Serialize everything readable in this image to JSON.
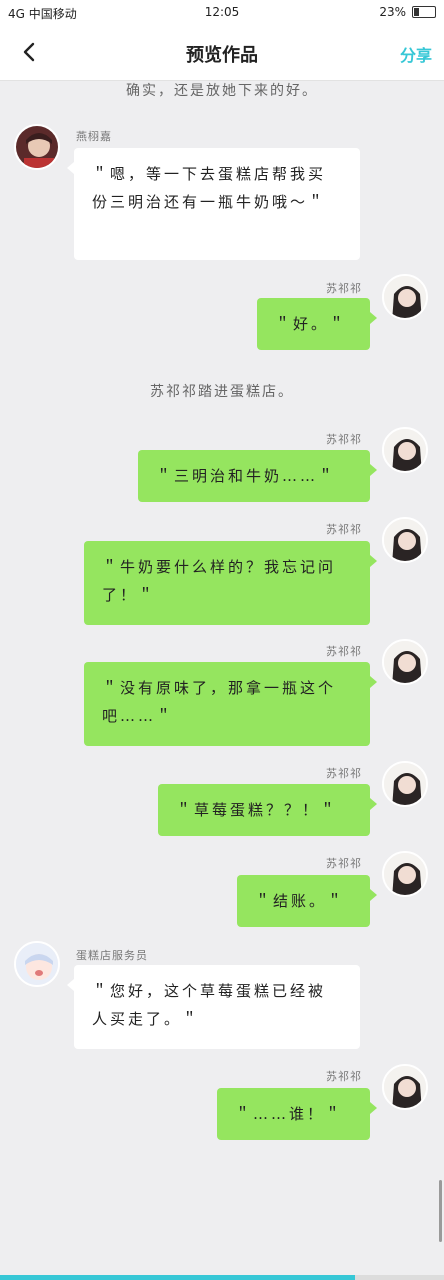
{
  "status_bar": {
    "signal": "4G",
    "carrier": "中国移动",
    "time": "12:05",
    "battery": "23%",
    "battery_level": 0.23
  },
  "nav": {
    "title": "预览作品",
    "share": "分享"
  },
  "narrations": [
    "确实，还是放她下来的好。",
    "苏祁祁踏进蛋糕店。"
  ],
  "messages": [
    {
      "name": "燕栩嘉",
      "text": "＂嗯，等一下去蛋糕店帮我买份三明治还有一瓶牛奶哦～＂",
      "side": "left"
    },
    {
      "name": "苏祁祁",
      "text": "＂好。＂",
      "side": "right"
    },
    {
      "name": "苏祁祁",
      "text": "＂三明治和牛奶……＂",
      "side": "right"
    },
    {
      "name": "苏祁祁",
      "text": "＂牛奶要什么样的？我忘记问了！＂",
      "side": "right"
    },
    {
      "name": "苏祁祁",
      "text": "＂没有原味了，那拿一瓶这个吧……＂",
      "side": "right"
    },
    {
      "name": "苏祁祁",
      "text": "＂草莓蛋糕？？！＂",
      "side": "right"
    },
    {
      "name": "苏祁祁",
      "text": "＂结账。＂",
      "side": "right"
    },
    {
      "name": "蛋糕店服务员",
      "text": "＂您好，这个草莓蛋糕已经被人买走了。＂",
      "side": "left"
    },
    {
      "name": "苏祁祁",
      "text": "＂……谁！＂",
      "side": "right"
    }
  ],
  "reading_progress": 0.8,
  "colors": {
    "accent": "#36c7d6",
    "bubble_right": "#95e55f",
    "bubble_left": "#ffffff",
    "background": "#eeeef0"
  },
  "icons": {
    "back": "chevron-left-icon",
    "avatar": "avatar-photo"
  }
}
